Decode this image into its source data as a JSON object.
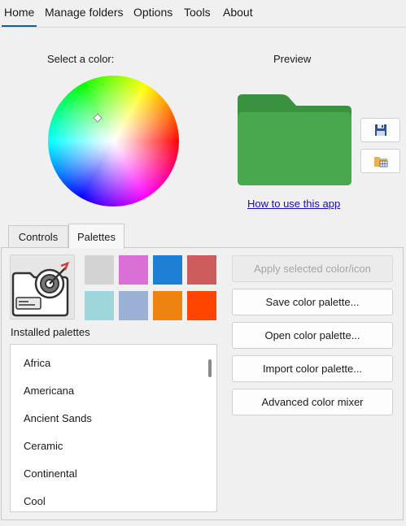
{
  "menu": [
    "Home",
    "Manage folders",
    "Options",
    "Tools",
    "About"
  ],
  "color_picker": {
    "label": "Select a color:",
    "wheel_icon": "color-wheel"
  },
  "preview": {
    "label": "Preview",
    "folder_color": "#48a84e",
    "folder_tab_color": "#3a9140"
  },
  "side_buttons": [
    {
      "name": "save-icon-button",
      "icon": "save-floppy-icon"
    },
    {
      "name": "open-folder-icon-button",
      "icon": "folder-grid-icon"
    }
  ],
  "link": {
    "text": "How to use this app"
  },
  "tabs": [
    {
      "label": "Controls",
      "active": false
    },
    {
      "label": "Palettes",
      "active": true
    }
  ],
  "palette_icon": "folder-target-icon",
  "swatches": [
    "#d3d3d3",
    "#da70d6",
    "#1e7fd4",
    "#cd5c5c",
    "#9fd6db",
    "#9ab0d4",
    "#ee8311",
    "#ff4500"
  ],
  "installed": {
    "label": "Installed palettes",
    "items": [
      "Africa",
      "Americana",
      "Ancient Sands",
      "Ceramic",
      "Continental",
      "Cool"
    ]
  },
  "actions": {
    "apply": "Apply selected color/icon",
    "save": "Save color palette...",
    "open": "Open color palette...",
    "import": "Import color palette...",
    "mixer": "Advanced color mixer"
  }
}
